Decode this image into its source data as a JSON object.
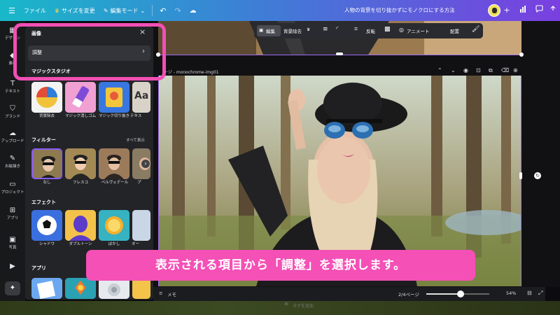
{
  "topbar": {
    "menu_icon": "menu-icon",
    "file": "ファイル",
    "resize": "サイズを変更",
    "edit_mode": "編集モード",
    "doc_title": "人物の背景を切り抜かずにモノクロにする方法"
  },
  "rail": {
    "items": [
      {
        "label": "デザイン",
        "icon": "layout-icon"
      },
      {
        "label": "素材",
        "icon": "shapes-icon"
      },
      {
        "label": "テキスト",
        "icon": "text-icon"
      },
      {
        "label": "ブランド",
        "icon": "brand-icon"
      },
      {
        "label": "アップロード",
        "icon": "upload-icon"
      },
      {
        "label": "お絵描き",
        "icon": "draw-icon"
      },
      {
        "label": "プロジェクト",
        "icon": "folder-icon"
      },
      {
        "label": "アプリ",
        "icon": "apps-icon"
      },
      {
        "label": "写真",
        "icon": "photo-icon"
      },
      {
        "label": "",
        "icon": "video-icon"
      }
    ]
  },
  "panel": {
    "title": "画像",
    "adjust": "調整",
    "magic_studio": "マジックスタジオ",
    "magic_items": [
      "背景除去",
      "マジック消しゴム",
      "マジック切り抜き",
      "テキス"
    ],
    "filters_label": "フィルター",
    "see_all": "すべて表示",
    "filter_items": [
      "なし",
      "フレスコ",
      "ベルヴェデール",
      "プ"
    ],
    "effects_label": "エフェクト",
    "effect_items": [
      "シャドウ",
      "ダブルトーン",
      "ぼかし",
      "オー"
    ],
    "apps_label": "アプリ"
  },
  "toolbar": {
    "edit": "編集",
    "bg_remove": "背景除去",
    "flip": "反転",
    "animate": "アニメート",
    "arrange": "配置"
  },
  "page": {
    "title": "ージ - monochrome-img01"
  },
  "bottombar": {
    "notes": "メモ",
    "page_count": "2/4ページ",
    "zoom": "54%",
    "zoom_level": 0.54
  },
  "notes_placeholder": "タグを追加",
  "caption": "表示される項目から「調整」を選択します。",
  "colors": {
    "highlight": "#f14fb4",
    "caption_bg": "#f450b6",
    "panel_bg": "#232428",
    "selection": "#a06cf0"
  }
}
